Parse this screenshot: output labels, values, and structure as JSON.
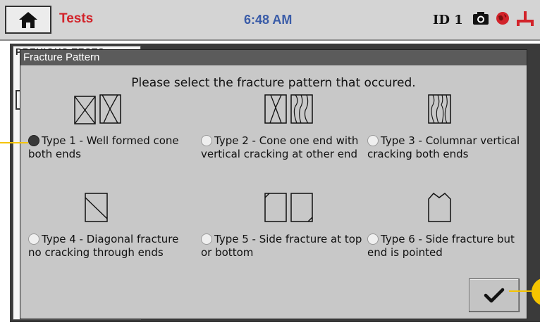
{
  "header": {
    "title": "Tests",
    "clock": "6:48 AM",
    "device_id": "ID 1",
    "icons": [
      "home-icon",
      "camera-icon",
      "globe-icon",
      "network-icon"
    ]
  },
  "background": {
    "sheet_label": "PREVIOUS TESTS"
  },
  "dialog": {
    "title": "Fracture Pattern",
    "prompt": "Please select the fracture pattern that occured.",
    "options": [
      {
        "label": "Type 1 - Well formed cone both ends",
        "selected": true
      },
      {
        "label": "Type 2 - Cone one end with vertical cracking at other end",
        "selected": false
      },
      {
        "label": "Type 3 - Columnar vertical cracking both ends",
        "selected": false
      },
      {
        "label": "Type 4 - Diagonal fracture no cracking through ends",
        "selected": false
      },
      {
        "label": "Type 5 - Side fracture at top or bottom",
        "selected": false
      },
      {
        "label": "Type 6 - Side fracture but end is pointed",
        "selected": false
      }
    ],
    "confirm_icon": "checkmark-icon"
  },
  "colors": {
    "title_red": "#d2232a",
    "clock_blue": "#3a5ca8",
    "callout_yellow": "#f5c400"
  }
}
